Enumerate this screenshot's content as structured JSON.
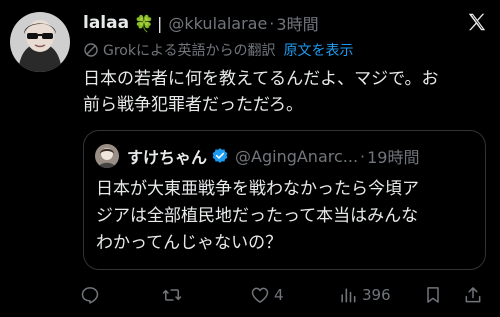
{
  "tweet": {
    "display_name": "lalaa",
    "name_emoji": "🍀",
    "name_bar": "|",
    "handle": "@kkulalarae",
    "separator": "·",
    "time": "3時間",
    "translation_note": "Grokによる英語からの翻訳",
    "show_original": "原文を表示",
    "text_lines": [
      "日本の若者に何を教えてるんだよ、マジで。お",
      "前ら戦争犯罪者だっただろ。"
    ]
  },
  "quote": {
    "display_name": "すけちゃん",
    "handle": "@AgingAnarc...",
    "separator": "·",
    "time": "19時間",
    "text_lines": [
      "日本が大東亜戦争を戦わなかったら今頃ア",
      "ジアは全部植民地だったって本当はみんな",
      "わかってんじゃないの？"
    ]
  },
  "actions": {
    "reply_count": "",
    "retweet_count": "",
    "like_count": "4",
    "views_count": "396"
  },
  "colors": {
    "background": "#000000",
    "text": "#e7e9ea",
    "muted": "#71767b",
    "link": "#1d9bf0",
    "verified": "#1d9bf0",
    "border": "#2f3336"
  },
  "icons": {
    "logo": "x-logo-icon",
    "translate": "grok-translate-icon",
    "verified": "verified-badge-icon",
    "reply": "reply-icon",
    "retweet": "retweet-icon",
    "like": "heart-icon",
    "views": "views-chart-icon",
    "bookmark": "bookmark-icon",
    "share": "share-icon"
  }
}
